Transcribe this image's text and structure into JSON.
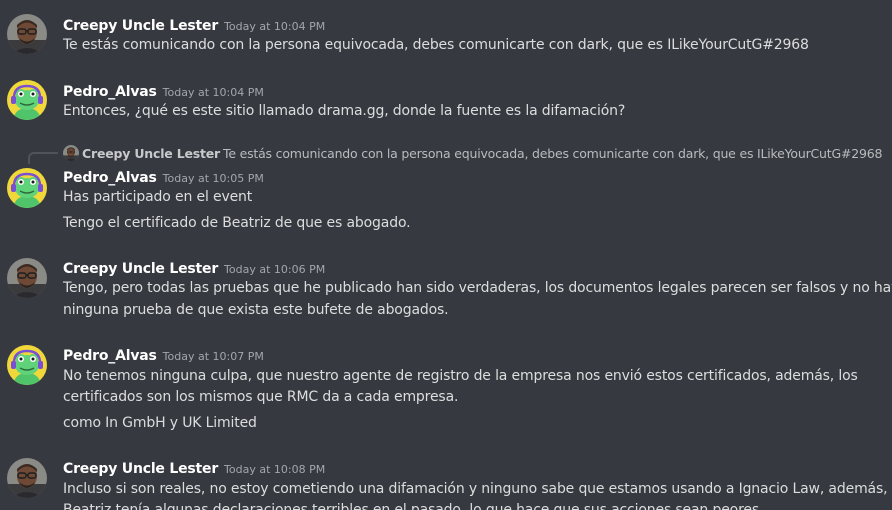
{
  "messages": [
    {
      "author": "Creepy Uncle Lester",
      "time": "Today at 10:04 PM",
      "lines": [
        "Te estás comunicando con la persona equivocada, debes comunicarte con dark, que es ILikeYourCutG#2968"
      ]
    },
    {
      "author": "Pedro_Alvas",
      "time": "Today at 10:04 PM",
      "lines": [
        "Entonces, ¿qué es este sitio llamado drama.gg, donde la fuente es la difamación?"
      ]
    },
    {
      "reply_to": {
        "author": "Creepy Uncle Lester",
        "text": "Te estás comunicando con la persona equivocada, debes comunicarte con dark, que es ILikeYourCutG#2968"
      },
      "author": "Pedro_Alvas",
      "time": "Today at 10:05 PM",
      "lines": [
        "Has participado en el event",
        "Tengo el certificado de Beatriz de que es abogado."
      ]
    },
    {
      "author": "Creepy Uncle Lester",
      "time": "Today at 10:06 PM",
      "lines": [
        "Tengo, pero todas las pruebas que he publicado han sido verdaderas, los documentos legales parecen ser falsos y no hay",
        "ninguna prueba de que exista este bufete de abogados."
      ]
    },
    {
      "author": "Pedro_Alvas",
      "time": "Today at 10:07 PM",
      "lines": [
        "No tenemos ninguna culpa, que nuestro agente de registro de la empresa nos envió estos certificados, además, los",
        "certificados son los mismos que RMC da a cada empresa.",
        "como In GmbH y UK Limited"
      ]
    },
    {
      "author": "Creepy Uncle Lester",
      "time": "Today at 10:08 PM",
      "lines": [
        "Incluso si son reales, no estoy cometiendo una difamación y ninguno sabe que estamos usando a Ignacio Law, además,",
        "Beatriz tenía algunas declaraciones terribles en el pasado, lo que hace que sus acciones sean peores."
      ]
    }
  ],
  "colors": {
    "background": "#36393f",
    "author": "#ffffff",
    "text": "#dcddde",
    "timestamp": "#a3a6aa"
  },
  "icons": {
    "lester_avatar": "man-with-glasses-avatar",
    "pedro_avatar": "green-frog-headphones-avatar"
  }
}
